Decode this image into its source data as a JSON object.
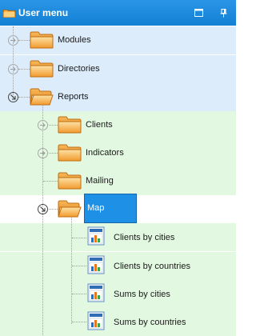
{
  "header": {
    "title": "User menu",
    "icons": {
      "title": "folder-icon",
      "restore": "window-restore-icon",
      "pin": "pin-icon"
    }
  },
  "tree": {
    "items": [
      {
        "label": "Modules",
        "level": 0,
        "kind": "folder",
        "state": "collapsed"
      },
      {
        "label": "Directories",
        "level": 0,
        "kind": "folder",
        "state": "collapsed"
      },
      {
        "label": "Reports",
        "level": 0,
        "kind": "folder",
        "state": "expanded"
      },
      {
        "label": "Clients",
        "level": 1,
        "kind": "folder",
        "state": "collapsed"
      },
      {
        "label": "Indicators",
        "level": 1,
        "kind": "folder",
        "state": "collapsed"
      },
      {
        "label": "Mailing",
        "level": 1,
        "kind": "folder",
        "state": "none"
      },
      {
        "label": "Map",
        "level": 1,
        "kind": "folder",
        "state": "expanded",
        "selected": true
      },
      {
        "label": "Clients by cities",
        "level": 2,
        "kind": "report"
      },
      {
        "label": "Clients by countries",
        "level": 2,
        "kind": "report"
      },
      {
        "label": "Sums by cities",
        "level": 2,
        "kind": "report"
      },
      {
        "label": "Sums by countries",
        "level": 2,
        "kind": "report"
      }
    ]
  },
  "colors": {
    "header": "#1a88dd",
    "row_blue": "#dcecfb",
    "row_green": "#e3f8e1",
    "selection": "#1e90e6",
    "folder": "#f5a623"
  }
}
